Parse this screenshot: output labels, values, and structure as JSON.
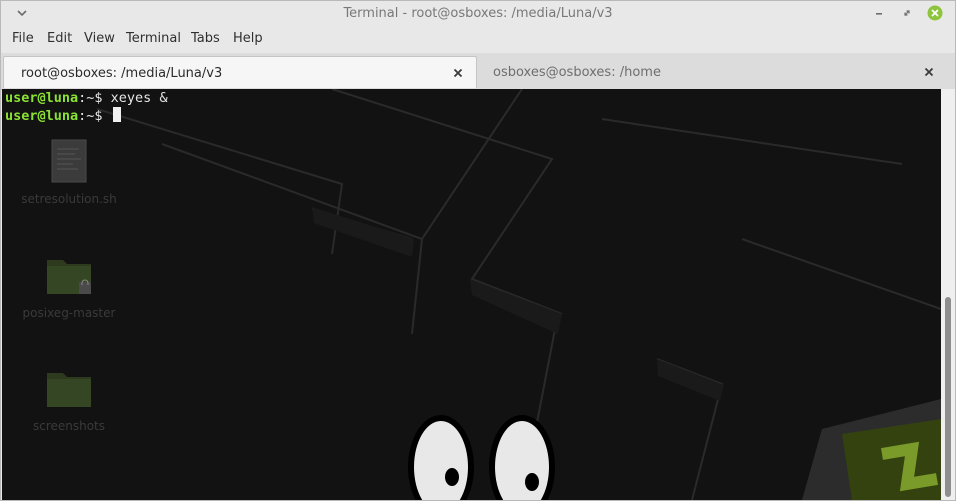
{
  "window": {
    "title": "Terminal - root@osboxes: /media/Luna/v3"
  },
  "menu": [
    "File",
    "Edit",
    "View",
    "Terminal",
    "Tabs",
    "Help"
  ],
  "tabs": [
    {
      "label": "root@osboxes: /media/Luna/v3",
      "active": true
    },
    {
      "label": "osboxes@osboxes: /home",
      "active": false
    }
  ],
  "terminal": {
    "lines": [
      {
        "user": "user@luna",
        "sep": ":~$",
        "cmd": " xeyes &"
      },
      {
        "user": "user@luna",
        "sep": ":~$",
        "cmd": " "
      }
    ]
  },
  "desktop_icons": [
    {
      "label": "setresolution.sh",
      "icon": "script-file-icon"
    },
    {
      "label": "posixeg-master",
      "icon": "locked-folder-icon"
    },
    {
      "label": "screenshots",
      "icon": "folder-icon"
    }
  ],
  "colors": {
    "prompt_user": "#8ae234",
    "terminal_bg": "#121212",
    "close_button": "#8cc43c"
  }
}
